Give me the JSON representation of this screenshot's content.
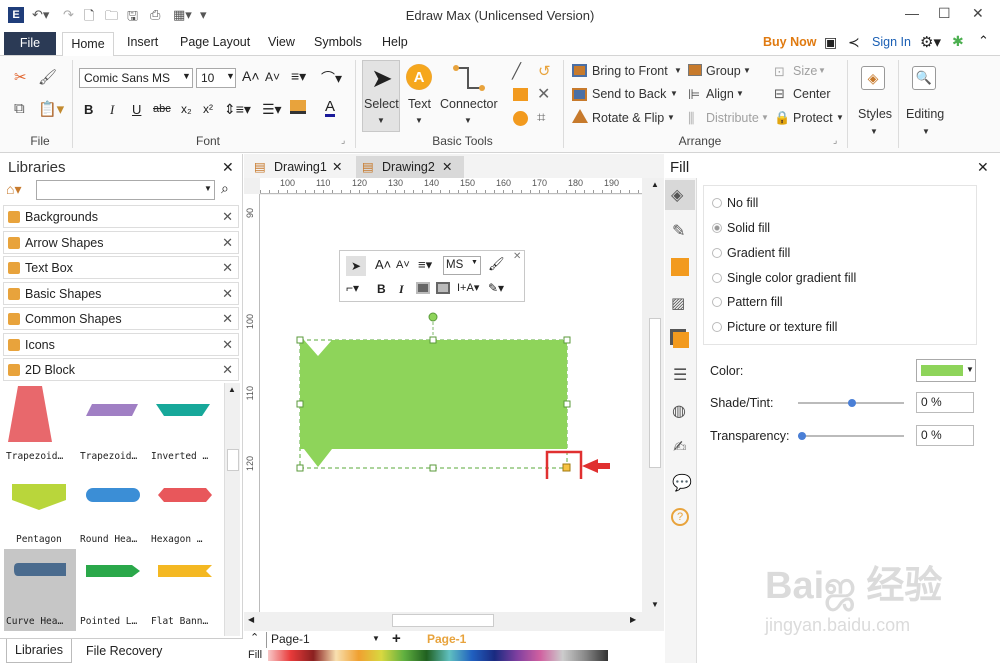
{
  "app": {
    "title": "Edraw Max (Unlicensed Version)"
  },
  "ribbon_tabs": [
    "File",
    "Home",
    "Insert",
    "Page Layout",
    "View",
    "Symbols",
    "Help"
  ],
  "header_right": {
    "buy_now": "Buy Now",
    "sign_in": "Sign In"
  },
  "font": {
    "family": "Comic Sans MS",
    "size": "10"
  },
  "groups": {
    "file": "File",
    "font": "Font",
    "basic_tools": "Basic Tools",
    "arrange": "Arrange"
  },
  "tools": {
    "select": "Select",
    "text": "Text",
    "connector": "Connector",
    "styles": "Styles",
    "editing": "Editing"
  },
  "arrange": {
    "bring_to_front": "Bring to Front",
    "send_to_back": "Send to Back",
    "rotate_flip": "Rotate & Flip",
    "group": "Group",
    "align": "Align",
    "distribute": "Distribute",
    "size": "Size",
    "center": "Center",
    "protect": "Protect"
  },
  "libraries": {
    "title": "Libraries",
    "items": [
      "Backgrounds",
      "Arrow Shapes",
      "Text Box",
      "Basic Shapes",
      "Common Shapes",
      "Icons",
      "2D Block"
    ],
    "shapes": [
      "Trapezoid…",
      "Trapezoid…",
      "Inverted …",
      "Pentagon",
      "Round Hea…",
      "Hexagon …",
      "Curve Hea…",
      "Pointed L…",
      "Flat Bann…"
    ],
    "bottom_tabs": [
      "Libraries",
      "File Recovery"
    ]
  },
  "documents": {
    "tabs": [
      "Drawing1",
      "Drawing2"
    ]
  },
  "ruler": {
    "top": [
      "100",
      "110",
      "120",
      "130",
      "140",
      "150",
      "160",
      "170",
      "180",
      "190"
    ],
    "left": [
      "90",
      "100",
      "110",
      "120"
    ]
  },
  "minitoolbar": {
    "font": "MS"
  },
  "page": {
    "current": "Page-1",
    "tab": "Page-1",
    "fill_label": "Fill"
  },
  "fill_panel": {
    "title": "Fill",
    "options": [
      "No fill",
      "Solid fill",
      "Gradient fill",
      "Single color gradient fill",
      "Pattern fill",
      "Picture or texture fill"
    ],
    "selected": "Solid fill",
    "color_label": "Color:",
    "shade_label": "Shade/Tint:",
    "shade_value": "0 %",
    "transparency_label": "Transparency:",
    "transparency_value": "0 %"
  },
  "colors": {
    "shape_fill": "#8ed45a",
    "accent_buy": "#e07a10",
    "file_tab": "#2b3a55",
    "highlight": "#e03030"
  },
  "watermark": {
    "main": "Baiஜ 经验",
    "sub": "jingyan.baidu.com"
  }
}
